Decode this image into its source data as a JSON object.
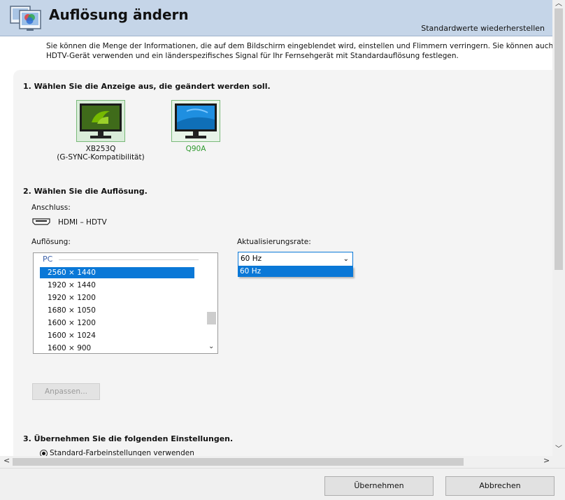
{
  "header": {
    "title": "Auflösung ändern",
    "restore_defaults": "Standardwerte wiederherstellen"
  },
  "intro": {
    "line1": "Sie können die Menge der Informationen, die auf dem Bildschirm eingeblendet wird, einstellen und Flimmern verringern. Sie können auch das HD-Format a",
    "line2": "HDTV-Gerät verwenden und ein länderspezifisches Signal für Ihr Fernsehgerät mit Standardauflösung festlegen."
  },
  "section1": {
    "title": "1. Wählen Sie die Anzeige aus, die geändert werden soll.",
    "displays": [
      {
        "line1": "XB253Q",
        "line2": "(G-SYNC-Kompatibilität)"
      },
      {
        "line1": "Q90A",
        "line2": ""
      }
    ]
  },
  "section2": {
    "title": "2. Wählen Sie die Auflösung.",
    "connection_label": "Anschluss:",
    "connection_value": "HDMI – HDTV",
    "resolution_label": "Auflösung:",
    "resolution_group": "PC",
    "resolutions": [
      "2560 × 1440",
      "1920 × 1440",
      "1920 × 1200",
      "1680 × 1050",
      "1600 × 1200",
      "1600 × 1024",
      "1600 × 900"
    ],
    "selected_resolution": "2560 × 1440",
    "refresh_label": "Aktualisierungsrate:",
    "refresh_value": "60 Hz",
    "refresh_options": [
      "60 Hz"
    ],
    "customize_button": "Anpassen..."
  },
  "section3": {
    "title": "3. Übernehmen Sie die folgenden Einstellungen.",
    "radio_partial": "Standard-Farbeinstellungen verwenden"
  },
  "footer": {
    "apply_button": "Übernehmen",
    "cancel_button": "Abbrechen"
  },
  "colors": {
    "header_bg": "#c5d5e8",
    "selection": "#0a78d7",
    "nvidia_green": "#76b900"
  }
}
